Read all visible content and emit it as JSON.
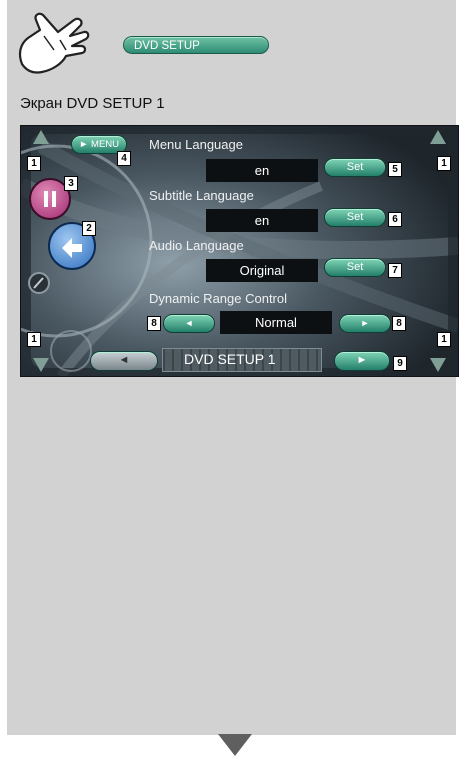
{
  "header": {
    "hand_icon": "pointing-hand-icon",
    "pill_label": "DVD SETUP"
  },
  "caption": "Экран DVD SETUP 1",
  "screen": {
    "menu_button": "► MENU",
    "settings": [
      {
        "label": "Menu Language",
        "value": "en",
        "button": "Set"
      },
      {
        "label": "Subtitle Language",
        "value": "en",
        "button": "Set"
      },
      {
        "label": "Audio Language",
        "value": "Original",
        "button": "Set"
      }
    ],
    "drc": {
      "label": "Dynamic Range Control",
      "value": "Normal",
      "left": "◄",
      "right": "►"
    },
    "bottom": {
      "prev": "◄",
      "title": "DVD SETUP 1",
      "next": "►"
    },
    "callouts": [
      "1",
      "1",
      "1",
      "1",
      "2",
      "3",
      "4",
      "5",
      "6",
      "7",
      "8",
      "8",
      "9"
    ]
  },
  "colors": {
    "accent": "#2e8c74",
    "panel": "#d2d2d2",
    "screen": "#262e35"
  }
}
